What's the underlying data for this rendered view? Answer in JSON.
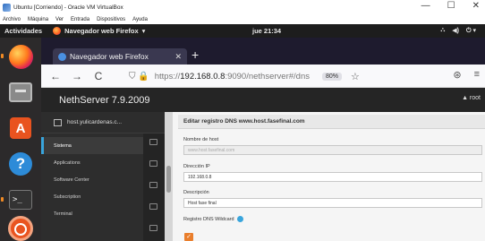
{
  "host": {
    "title": "Ubuntu [Corriendo] - Oracle VM VirtualBox",
    "controls": {
      "minimize": "—",
      "maximize": "☐",
      "close": "✕"
    },
    "menu": [
      "Archivo",
      "Máquina",
      "Ver",
      "Entrada",
      "Dispositivos",
      "Ayuda"
    ]
  },
  "gnome": {
    "activities": "Actividades",
    "app": "Navegador web Firefox",
    "app_caret": "▾",
    "clock": "jue 21:34",
    "tray": [
      "⛬",
      "◀)",
      "⏻ ▾"
    ]
  },
  "dock": {
    "items": [
      "firefox",
      "files",
      "software",
      "help",
      "terminal",
      "ubuntu"
    ],
    "software_glyph": "A",
    "help_glyph": "?",
    "terminal_glyph": ">_"
  },
  "browser": {
    "tab_title": "Navegador web Firefox",
    "tab_close": "✕",
    "new_tab": "+",
    "back": "←",
    "forward": "→",
    "reload": "C",
    "shield": "⛉ 🔒",
    "url_prefix": "https://",
    "url_host": "192.168.0.8",
    "url_rest": ":9090/nethserver#/dns",
    "zoom": "80%",
    "star": "☆",
    "right_icons": [
      "⊛",
      "≡"
    ]
  },
  "nethserver": {
    "brand": "NethServer 7.9.2009",
    "user": "▲ root",
    "host": "host.yulicardenas.c...",
    "menu": [
      {
        "label": "Sistema",
        "active": true
      },
      {
        "label": "Applications",
        "active": false
      },
      {
        "label": "Software Center",
        "active": false
      },
      {
        "label": "Subscription",
        "active": false
      },
      {
        "label": "Terminal",
        "active": false
      }
    ],
    "panel_title": "Editar registro DNS www.host.fasefinal.com",
    "fields": {
      "hostname_label": "Nombre de host",
      "hostname_value": "www.host.fasefinal.com",
      "ip_label": "Dirección IP",
      "ip_value": "192.168.0.8",
      "desc_label": "Descripción",
      "desc_value": "Host fase final",
      "wildcard_label": "Registro DNS Wildcard",
      "wildcard_checked": "✓"
    }
  }
}
